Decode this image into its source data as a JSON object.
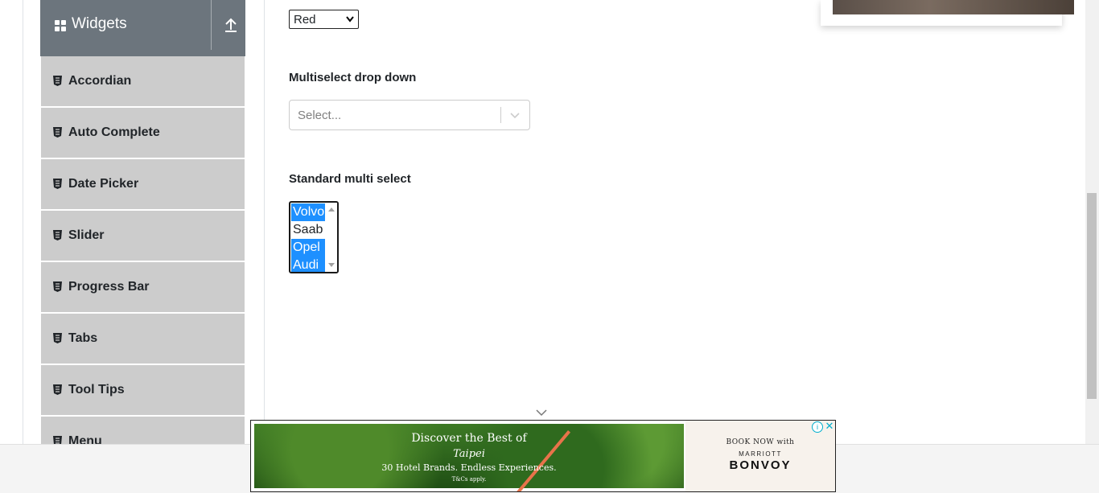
{
  "sidebar": {
    "group_title": "Widgets",
    "items": [
      {
        "label": "Accordian"
      },
      {
        "label": "Auto Complete"
      },
      {
        "label": "Date Picker"
      },
      {
        "label": "Slider"
      },
      {
        "label": "Progress Bar"
      },
      {
        "label": "Tabs"
      },
      {
        "label": "Tool Tips"
      },
      {
        "label": "Menu"
      }
    ]
  },
  "main": {
    "old_select": {
      "value": "Red"
    },
    "multiselect": {
      "title": "Multiselect drop down",
      "placeholder": "Select..."
    },
    "standard_multi": {
      "title": "Standard multi select",
      "options": [
        {
          "label": "Volvo",
          "selected": true
        },
        {
          "label": "Saab",
          "selected": false
        },
        {
          "label": "Opel",
          "selected": true
        },
        {
          "label": "Audi",
          "selected": true
        }
      ]
    }
  },
  "ad_banner": {
    "headline_1": "Discover the Best of",
    "headline_2": "Taipei",
    "tagline": "30 Hotel Brands. Endless Experiences.",
    "terms": "T&Cs apply.",
    "book_now": "BOOK NOW with",
    "brand_top": "MARRIOTT",
    "brand_main": "BONVOY",
    "info_glyph": "i",
    "close_glyph": "✕"
  },
  "colors": {
    "sidebar_header": "#6c757d",
    "sidebar_item": "#cccccc",
    "selection": "#1e90ff",
    "ad_accent": "#00aecd"
  }
}
